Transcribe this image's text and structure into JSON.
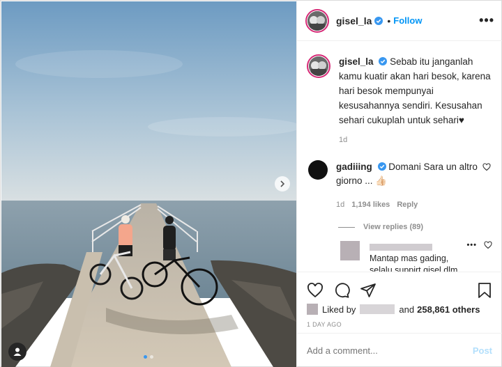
{
  "post": {
    "username": "gisel_la",
    "follow_label": "Follow",
    "more_label": "•••",
    "caption_text": "Sebab itu janganlah kamu kuatir akan hari besok, karena hari besok mempunyai kesusahannya sendiri. Kesusahan sehari cukuplah untuk sehari♥",
    "caption_time": "1d"
  },
  "comments": [
    {
      "username": "gadiiing",
      "text": "Domani Sara un altro giorno ... 👍🏻",
      "time": "1d",
      "likes": "1,194 likes",
      "reply_label": "Reply",
      "view_replies": "View replies (89)"
    }
  ],
  "reply": {
    "text": "Mantap mas gading, selalu suppirt gisel dlm segala hal, manusia tak ada yg sempurna, saya"
  },
  "likes": {
    "prefix": "Liked by",
    "middle": "and",
    "count": "258,861 others"
  },
  "timestamp": "1 DAY AGO",
  "add_comment": {
    "placeholder": "Add a comment...",
    "post_label": "Post"
  },
  "colors": {
    "accent": "#0095f6",
    "verified": "#3897f0",
    "post_disabled": "#b2dffc"
  }
}
